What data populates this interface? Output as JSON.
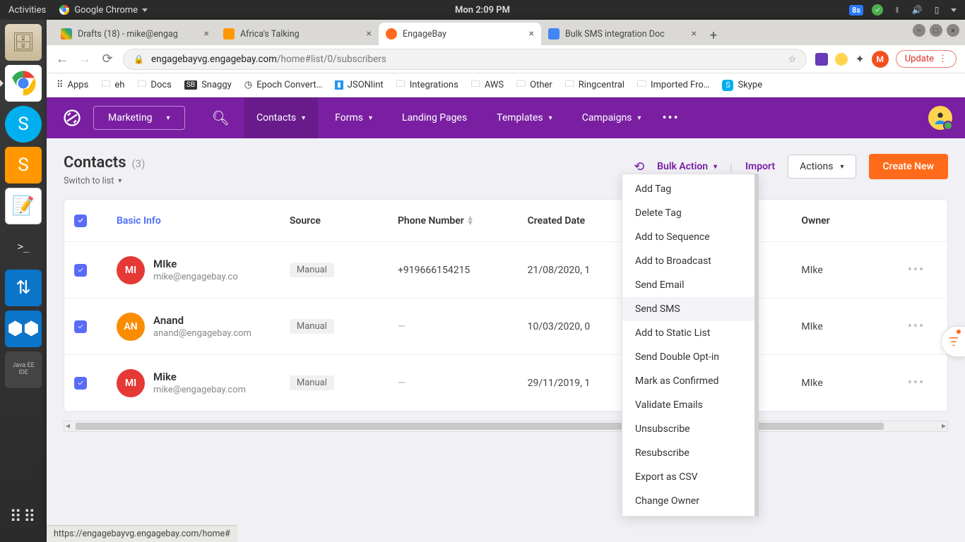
{
  "os": {
    "activities": "Activities",
    "app_indicator": "Google Chrome",
    "clock": "Mon  2:09 PM",
    "badge_text": "8s"
  },
  "launcher": {
    "items": [
      "files",
      "chrome",
      "skype",
      "sublime",
      "text-editor",
      "terminal",
      "transfer",
      "modules",
      "java-ide"
    ]
  },
  "chrome": {
    "tabs": [
      {
        "title": "Drafts (18) - mike@engag",
        "favicon": "gmail",
        "active": false
      },
      {
        "title": "Africa's Talking",
        "favicon": "at",
        "active": false
      },
      {
        "title": "EngageBay",
        "favicon": "eb",
        "active": true
      },
      {
        "title": "Bulk SMS integration Doc",
        "favicon": "gdocs",
        "active": false
      }
    ],
    "url_host": "engagebayvg.engagebay.com",
    "url_path": "/home#list/0/subscribers",
    "update_label": "Update",
    "bookmarks": [
      "Apps",
      "eh",
      "Docs",
      "Snaggy",
      "Epoch Convert…",
      "JSONlint",
      "Integrations",
      "AWS",
      "Other",
      "Ringcentral",
      "Imported Fro…",
      "Skype"
    ],
    "status_url": "https://engagebayvg.engagebay.com/home#"
  },
  "app": {
    "module": "Marketing",
    "nav": [
      "Contacts",
      "Forms",
      "Landing Pages",
      "Templates",
      "Campaigns"
    ],
    "nav_active": 0,
    "page_title": "Contacts",
    "contact_count": "(3)",
    "switch_label": "Switch to list",
    "bulk_label": "Bulk Action",
    "import_label": "Import",
    "actions_label": "Actions",
    "create_label": "Create New",
    "columns": [
      "Basic Info",
      "Source",
      "Phone Number",
      "Created Date",
      "",
      "Owner"
    ],
    "rows": [
      {
        "initials": "MI",
        "color": "#e53935",
        "name": "MIke",
        "email": "mike@engagebay.co",
        "source": "Manual",
        "phone": "+919666154215",
        "created": "21/08/2020, 1",
        "owner": "MIke"
      },
      {
        "initials": "AN",
        "color": "#fb8c00",
        "name": "Anand",
        "email": "anand@engagebay.com",
        "source": "Manual",
        "phone": "—",
        "created": "10/03/2020, 0",
        "owner": "MIke"
      },
      {
        "initials": "MI",
        "color": "#e53935",
        "name": "Mike",
        "email": "mike@engagebay.com",
        "source": "Manual",
        "phone": "—",
        "created": "29/11/2019, 1",
        "owner": "MIke"
      }
    ],
    "bulk_menu": [
      "Add Tag",
      "Delete Tag",
      "Add to Sequence",
      "Add to Broadcast",
      "Send Email",
      "Send SMS",
      "Add to Static List",
      "Send Double Opt-in",
      "Mark as Confirmed",
      "Validate Emails",
      "Unsubscribe",
      "Resubscribe",
      "Export as CSV",
      "Change Owner"
    ],
    "bulk_menu_hover": 5
  }
}
